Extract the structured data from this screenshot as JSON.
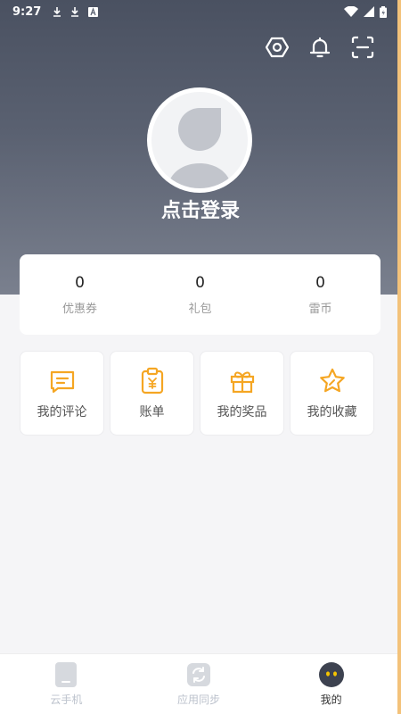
{
  "status_bar": {
    "time": "9:27",
    "icons_left": [
      "download-icon",
      "download-icon",
      "text-icon"
    ],
    "icons_right": [
      "wifi-icon",
      "signal-icon",
      "battery-icon"
    ]
  },
  "header": {
    "actions": [
      "settings-icon",
      "bell-icon",
      "scan-icon"
    ]
  },
  "profile": {
    "login_text": "点击登录"
  },
  "stats": [
    {
      "value": "0",
      "label": "优惠券"
    },
    {
      "value": "0",
      "label": "礼包"
    },
    {
      "value": "0",
      "label": "雷币"
    }
  ],
  "features": [
    {
      "label": "我的评论",
      "icon": "comment-icon"
    },
    {
      "label": "账单",
      "icon": "bill-icon"
    },
    {
      "label": "我的奖品",
      "icon": "gift-icon"
    },
    {
      "label": "我的收藏",
      "icon": "star-icon"
    }
  ],
  "bottom_nav": [
    {
      "label": "云手机",
      "icon": "phone-icon",
      "active": false
    },
    {
      "label": "应用同步",
      "icon": "sync-icon",
      "active": false
    },
    {
      "label": "我的",
      "icon": "profile-face-icon",
      "active": true
    }
  ],
  "colors": {
    "accent": "#f5a623",
    "hero_top": "#4a5161",
    "hero_bottom": "#7a808e",
    "background": "#f5f5f7"
  }
}
